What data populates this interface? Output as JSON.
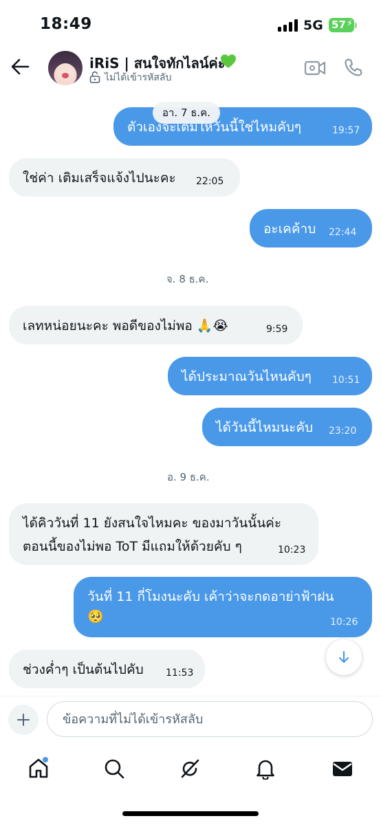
{
  "status_bar": {
    "time": "18:49",
    "network": "5G",
    "battery": "57"
  },
  "header": {
    "contact_name": "iRiS | สนใจทักไลน์ค่ะ",
    "encryption_label": "ไม่ได้เข้ารหัสลับ",
    "heart_color": "#5ac73d"
  },
  "conversation": {
    "floating_date": "อา. 7 ธ.ค.",
    "messages": [
      {
        "dir": "out",
        "text": "ตัวเองจะเติมให้วันนี้ใช่ไหมคับๆ",
        "time": "19:57"
      },
      {
        "dir": "in",
        "text": "ใช่ค่า เติมเสร็จแจ้งไปนะคะ",
        "time": "22:05"
      },
      {
        "dir": "out",
        "text": "อะเคค้าบ",
        "time": "22:44"
      },
      {
        "date": "จ. 8 ธ.ค."
      },
      {
        "dir": "in",
        "text": "เลทหน่อยนะคะ พอดีของไม่พอ 🙏😭",
        "time": "9:59"
      },
      {
        "dir": "out",
        "text": "ได้ประมาณวันไหนคับๆ",
        "time": "10:51"
      },
      {
        "dir": "out",
        "text": "ได้วันนี้ไหมนะคับ",
        "time": "23:20"
      },
      {
        "date": "อ. 9 ธ.ค."
      },
      {
        "dir": "in",
        "line1": "ได้คิววันที่ 11 ยังสนใจไหมคะ ของมาวันนั้นค่ะ",
        "line2": "ตอนนี้ของไม่พอ ToT มีแถมให้ด้วยคับ ๆ",
        "time": "10:23"
      },
      {
        "dir": "out",
        "line1": "วันที่ 11 กี่โมงนะคับ เค้าว่าจะกดอาย่าฟ้าฝน",
        "line2": "🥺",
        "time": "10:26"
      },
      {
        "dir": "in",
        "text": "ช่วงค่ำๆ เป็นต้นไปคับ",
        "time": "11:53"
      }
    ]
  },
  "composer": {
    "placeholder": "ข้อความที่ไม่ได้เข้ารหัสลับ"
  },
  "colors": {
    "accent": "#4a99e9",
    "incoming_bubble": "#eff3f4"
  },
  "tabs": [
    {
      "icon": "home-icon",
      "active": true,
      "has_badge": true
    },
    {
      "icon": "search-icon",
      "active": false
    },
    {
      "icon": "grok-icon",
      "active": false
    },
    {
      "icon": "bell-icon",
      "active": false
    },
    {
      "icon": "mail-icon",
      "active": true
    }
  ]
}
